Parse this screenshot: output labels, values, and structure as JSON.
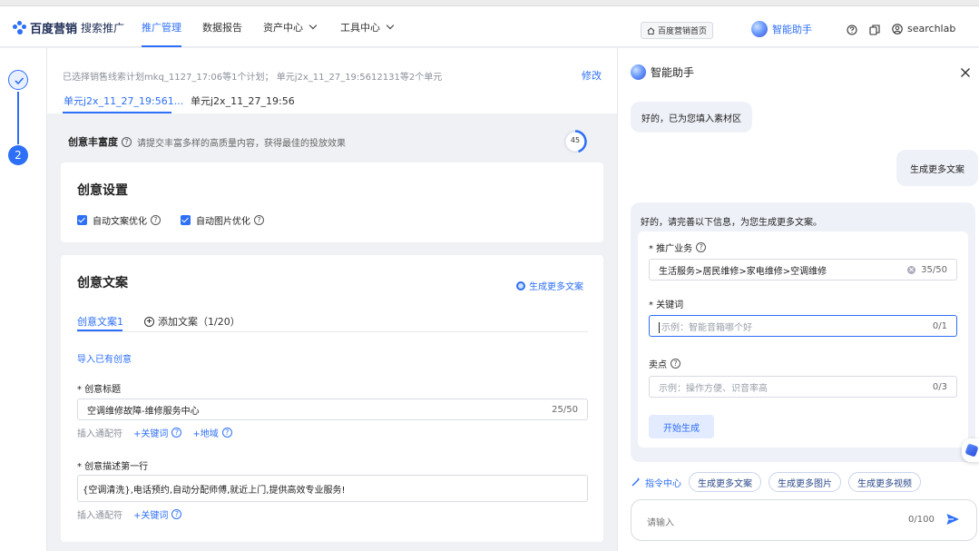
{
  "header": {
    "logo_text": "百度营销",
    "logo_sub": "搜索推广",
    "nav": [
      {
        "label": "推广管理"
      },
      {
        "label": "数据报告"
      },
      {
        "label": "资产中心"
      },
      {
        "label": "工具中心"
      }
    ],
    "home_button": "百度营销首页",
    "assistant": "智能助手",
    "username": "searchlab"
  },
  "steps": {
    "step2": "2"
  },
  "main": {
    "summary_text": "已选择销售线索计划mkq_1127_17:06等1个计划；  单元j2x_11_27_19:5612131等2个单元",
    "modify": "修改",
    "unit_tabs": [
      "单元j2x_11_27_19:561...",
      "单元j2x_11_27_19:56"
    ],
    "richness_title": "创意丰富度",
    "richness_desc": "请提交丰富多样的高质量内容，获得最佳的投放效果",
    "richness_score": "45",
    "settings": {
      "title": "创意设置",
      "auto_copy": "自动文案优化",
      "auto_image": "自动图片优化"
    },
    "copy": {
      "title": "创意文案",
      "generate_more": "生成更多文案",
      "tab1": "创意文案1",
      "add_copy": "添加文案（1/20）",
      "import": "导入已有创意",
      "title_label": "* 创意标题",
      "title_value": "空调维修故障-维修服务中心",
      "title_count": "25/50",
      "insert_wildcard": "插入通配符",
      "add_keyword": "+关键词",
      "add_region": "+地域",
      "desc_label": "* 创意描述第一行",
      "desc_value": "{空调清洗},电话预约,自动分配师傅,就近上门,提供高效专业服务!",
      "insert_wildcard2": "插入通配符",
      "add_keyword2": "+关键词"
    }
  },
  "panel": {
    "title": "智能助手",
    "msg_assistant_1": "好的，已为您填入素材区",
    "msg_user_1": "生成更多文案",
    "form_intro": "好的，请完善以下信息，为您生成更多文案。",
    "business_label": "* 推广业务",
    "business_value": "生活服务>居民维修>家电维修>空调维修",
    "business_count": "35/50",
    "keyword_label": "* 关键词",
    "keyword_placeholder": "示例：智能音箱哪个好",
    "keyword_count": "0/1",
    "selling_label": "卖点",
    "selling_placeholder": "示例：操作方便、识音率高",
    "selling_count": "0/3",
    "start_button": "开始生成",
    "command_center": "指令中心",
    "chips": [
      "生成更多文案",
      "生成更多图片",
      "生成更多视频"
    ],
    "input_placeholder": "请输入",
    "input_count": "0/100"
  },
  "colors": {
    "accent": "#2d6ff7",
    "panel_bubble": "#eef1f8",
    "background": "#f0f1f5"
  }
}
